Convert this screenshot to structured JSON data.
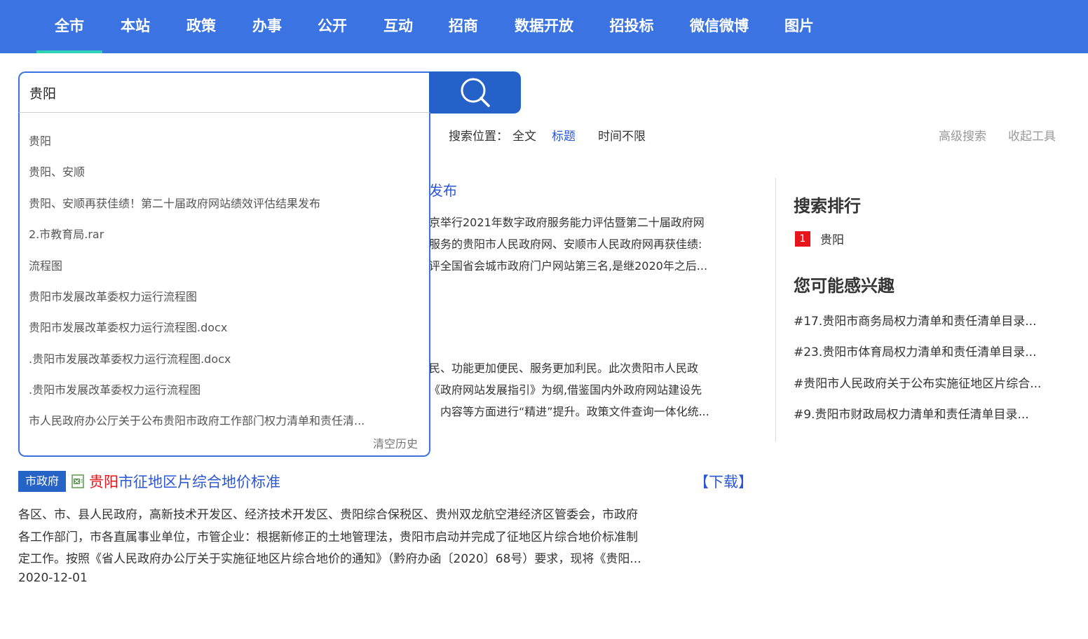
{
  "nav": {
    "tabs": [
      {
        "label": "全市",
        "active": true
      },
      {
        "label": "本站"
      },
      {
        "label": "政策"
      },
      {
        "label": "办事"
      },
      {
        "label": "公开"
      },
      {
        "label": "互动"
      },
      {
        "label": "招商"
      },
      {
        "label": "数据开放"
      },
      {
        "label": "招投标"
      },
      {
        "label": "微信微博"
      },
      {
        "label": "图片"
      }
    ]
  },
  "search": {
    "value": "贵阳",
    "button_icon": "search-icon"
  },
  "filters": {
    "position_label": "搜索位置：",
    "fulltext": "全文",
    "title": "标题",
    "time": "时间不限",
    "advanced": "高级搜索",
    "collapse": "收起工具"
  },
  "dropdown": {
    "items": [
      "贵阳",
      "贵阳、安顺",
      "贵阳、安顺再获佳绩！第二十届政府网站绩效评估结果发布",
      "2.市教育局.rar",
      "流程图",
      "贵阳市发展改革委权力运行流程图",
      "贵阳市发展改革委权力运行流程图.docx",
      ".贵阳市发展改革委权力运行流程图.docx",
      ".贵阳市发展改革委权力运行流程图",
      "市人民政府办公厅关于公布贵阳市政府工作部门权力清单和责任清..."
    ],
    "clear_label": "清空历史"
  },
  "background_results": {
    "title_fragment": "发布",
    "lines_a": [
      "京举行2021年数字政府服务能力评估暨第二十届政府网",
      "服务的贵阳市人民政府网、安顺市人民政府网再获佳绩:",
      "评全国省会城市政府门户网站第三名,是继2020年之后..."
    ],
    "lines_b": [
      "民、功能更加便民、服务更加利民。此次贵阳市人民政",
      "《政府网站发展指引》为纲,借鉴国内外政府网站建设先",
      "内容等方面进行“精进”提升。政策文件查询一体化统..."
    ]
  },
  "sidebar": {
    "ranking_title": "搜索排行",
    "ranking": [
      {
        "rank": "1",
        "text": "贵阳"
      }
    ],
    "interest_title": "您可能感兴趣",
    "interests": [
      "#17.贵阳市商务局权力清单和责任清单目录...",
      "#23.贵阳市体育局权力清单和责任清单目录...",
      "#贵阳市人民政府关于公布实施征地区片综合...",
      "#9.贵阳市财政局权力清单和责任清单目录..."
    ]
  },
  "result": {
    "tag": "市政府",
    "file_icon": "excel-file-icon",
    "title_highlight": "贵阳",
    "title_rest": "市征地区片综合地价标准",
    "download": "【下载】",
    "lines": [
      "各区、市、县人民政府，高新技术开发区、经济技术开发区、贵阳综合保税区、贵州双龙航空港经济区管委会，市政府",
      "各工作部门，市各直属事业单位，市管企业：根据新修正的土地管理法，贵阳市启动并完成了征地区片综合地价标准制",
      "定工作。按照《省人民政府办公厅关于实施征地区片综合地价的通知》（黔府办函〔2020〕68号）要求，现将《贵阳..."
    ],
    "date": "2020-12-01"
  },
  "colors": {
    "nav_bg": "#3b74e2",
    "active_underline": "#2ed3b5",
    "search_button": "#2462c9",
    "link": "#2b57d6",
    "highlight": "#e8141b"
  }
}
